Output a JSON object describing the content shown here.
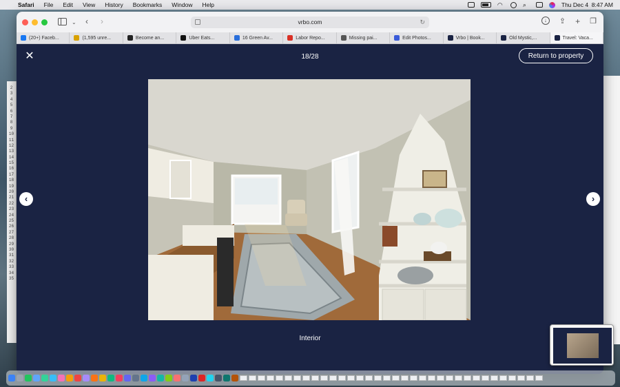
{
  "menubar": {
    "app_name": "Safari",
    "items": [
      "File",
      "Edit",
      "View",
      "History",
      "Bookmarks",
      "Window",
      "Help"
    ],
    "clock": "Thu Dec 4  8:47 AM"
  },
  "browser": {
    "address": "vrbo.com",
    "tabs": [
      {
        "label": "(20+) Faceb...",
        "color": "#1877f2"
      },
      {
        "label": "(1,595 unre...",
        "color": "#d8a100"
      },
      {
        "label": "Become an...",
        "color": "#222222"
      },
      {
        "label": "Uber Eats...",
        "color": "#111111"
      },
      {
        "label": "16 Green Av...",
        "color": "#2a6fdb"
      },
      {
        "label": "Labor Repo...",
        "color": "#d93025"
      },
      {
        "label": "Missing pai...",
        "color": "#555555"
      },
      {
        "label": "Edit Photos...",
        "color": "#3a5bd9"
      },
      {
        "label": "Vrbo | Book...",
        "color": "#1a2343"
      },
      {
        "label": "Old Mystic,...",
        "color": "#1a2343"
      },
      {
        "label": "Travel: Vaca...",
        "color": "#1a2343"
      }
    ]
  },
  "gallery": {
    "counter": "18/28",
    "return_label": "Return to property",
    "caption": "Interior",
    "prev_label": "‹",
    "next_label": "›",
    "close_label": "✕"
  },
  "spreadsheet_rows": [
    "2",
    "3",
    "4",
    "5",
    "6",
    "7",
    "8",
    "9",
    "10",
    "11",
    "12",
    "13",
    "14",
    "15",
    "16",
    "17",
    "18",
    "19",
    "20",
    "21",
    "22",
    "23",
    "24",
    "25",
    "26",
    "27",
    "28",
    "29",
    "30",
    "31",
    "32",
    "33",
    "34",
    "35"
  ],
  "colors": {
    "gallery_bg": "#1a2343",
    "accent": "#ffffff"
  }
}
